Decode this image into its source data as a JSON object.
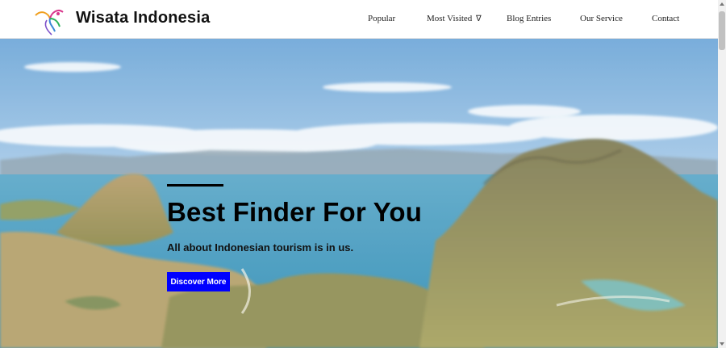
{
  "navbar": {
    "logo_icon": "bird-logo-icon",
    "brand": "Wisata Indonesia",
    "items": [
      {
        "label": "Popular"
      },
      {
        "label": "Most Visited",
        "caret": "∇"
      },
      {
        "label": "Blog Entries"
      },
      {
        "label": "Our Service"
      },
      {
        "label": "Contact"
      }
    ]
  },
  "hero": {
    "background": "island-landscape-photo",
    "title": "Best Finder For You",
    "subtitle": "All about Indonesian tourism is in us.",
    "cta_label": "Discover More",
    "cta_color": "#0000ff"
  },
  "scrollbar": {
    "track": "#f1f1f1",
    "thumb": "#c1c1c1"
  }
}
